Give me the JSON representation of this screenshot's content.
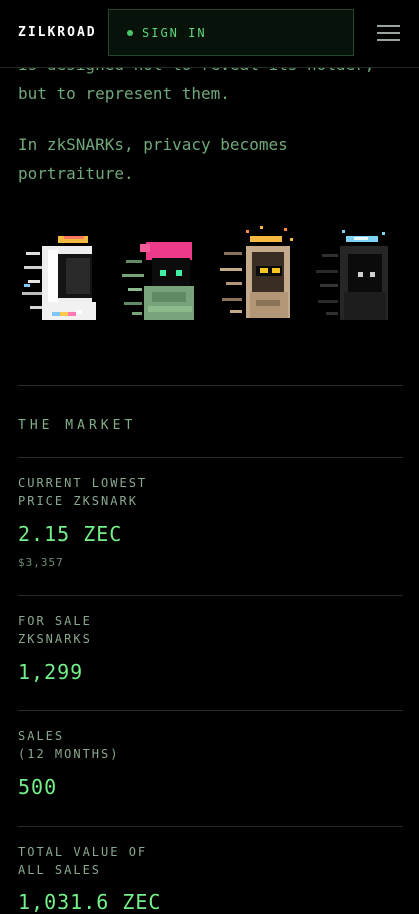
{
  "header": {
    "logo": "ZILKROAD",
    "signin_label": "SIGN IN"
  },
  "intro": {
    "line_top": "is designed not to reveal its holder,",
    "line_top_2": "but to represent them.",
    "para2": "In zkSNARKs, privacy becomes portraiture."
  },
  "avatars": [
    {
      "name": "astronaut-helmet"
    },
    {
      "name": "pink-beanie-hooded"
    },
    {
      "name": "gold-halo-shades"
    },
    {
      "name": "dark-hood-blue-halo"
    }
  ],
  "market": {
    "title": "THE MARKET",
    "stats": [
      {
        "label_1": "CURRENT LOWEST",
        "label_2": "PRICE ZKSNARK",
        "value": "2.15 ZEC",
        "sub": "$3,357"
      },
      {
        "label_1": "FOR SALE",
        "label_2": "ZKSNARKS",
        "value": "1,299"
      },
      {
        "label_1": "SALES",
        "label_2": "(12 MONTHS)",
        "value": "500"
      },
      {
        "label_1": "TOTAL VALUE OF",
        "label_2": "ALL SALES",
        "value": "1,031.6 ZEC"
      }
    ]
  },
  "colors": {
    "background": "#000000",
    "accent": "#74f08a",
    "text": "#6fa87a"
  }
}
